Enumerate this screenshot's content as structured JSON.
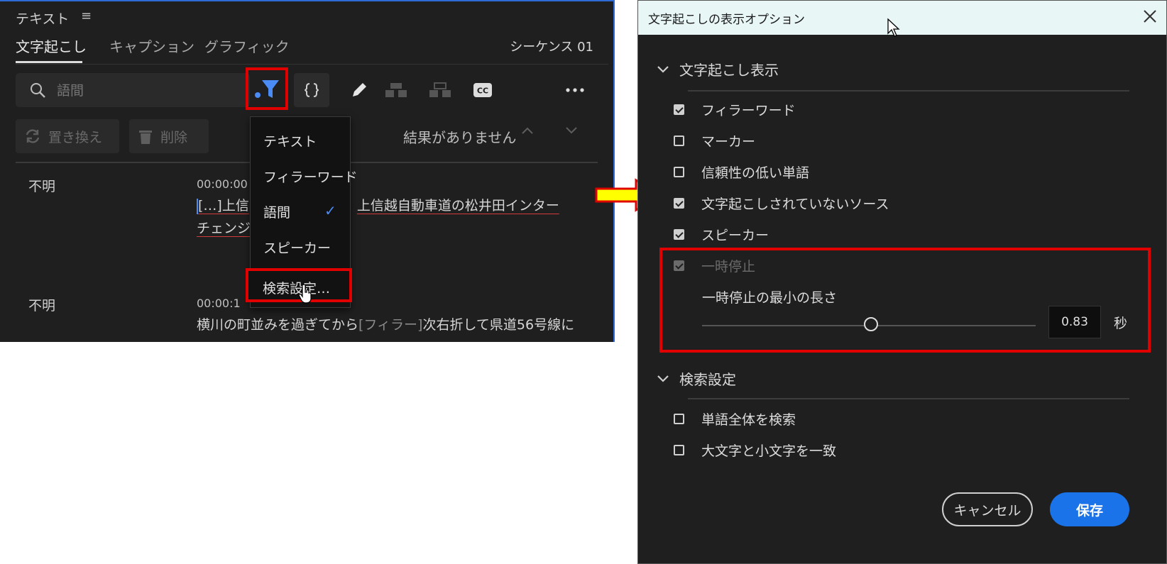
{
  "colors": {
    "accent_blue": "#1a73e8",
    "highlight_red": "#e00000",
    "panel_bg": "#1f1f1f",
    "arrow_yellow": "#ffff00"
  },
  "left_panel": {
    "title": "テキスト",
    "menu_icon": "hamburger-icon",
    "tabs": [
      {
        "label": "文字起こし",
        "active": true
      },
      {
        "label": "キャプション",
        "active": false
      },
      {
        "label": "グラフィック",
        "active": false
      }
    ],
    "sequence_name": "シーケンス 01",
    "search": {
      "value": "",
      "placeholder": "語間"
    },
    "buttons": {
      "replace": "置き換え",
      "delete": "削除"
    },
    "results": "結果がありません",
    "segments": [
      {
        "speaker": "不明",
        "time": "00:00:00",
        "line1_start": "[…]上信",
        "line1_end": "上信越自動車道の松井田インター",
        "line2": "チェンジを"
      },
      {
        "speaker": "不明",
        "time": "00:00:1",
        "line1_a": "横川の町並みを過ぎてから",
        "line1_filler": "[フィラー]",
        "line1_b": "次右折して県道56号線に"
      }
    ],
    "filter_menu": {
      "items": [
        "テキスト",
        "フィラーワード",
        "語間",
        "スピーカー"
      ],
      "checked": "語間",
      "search_settings": "検索設定…"
    }
  },
  "dialog": {
    "title": "文字起こしの表示オプション",
    "section_display": "文字起こし表示",
    "options": [
      {
        "label": "フィラーワード",
        "checked": true
      },
      {
        "label": "マーカー",
        "checked": false
      },
      {
        "label": "信頼性の低い単語",
        "checked": false
      },
      {
        "label": "文字起こしされていないソース",
        "checked": true
      },
      {
        "label": "スピーカー",
        "checked": true
      },
      {
        "label": "一時停止",
        "checked": true,
        "disabled": true
      }
    ],
    "min_length_label": "一時停止の最小の長さ",
    "min_length_value": "0.83",
    "seconds_unit": "秒",
    "section_search": "検索設定",
    "search_options": [
      {
        "label": "単語全体を検索",
        "checked": false
      },
      {
        "label": "大文字と小文字を一致",
        "checked": false
      }
    ],
    "cancel": "キャンセル",
    "save": "保存"
  }
}
